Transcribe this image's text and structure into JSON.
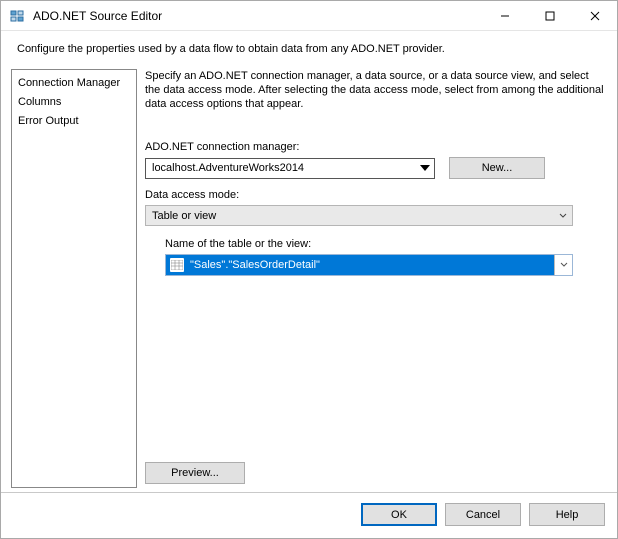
{
  "window": {
    "title": "ADO.NET Source Editor"
  },
  "description": "Configure the properties used by a data flow to obtain data from any ADO.NET provider.",
  "sidebar": {
    "items": [
      {
        "label": "Connection Manager"
      },
      {
        "label": "Columns"
      },
      {
        "label": "Error Output"
      }
    ]
  },
  "main": {
    "instructions": "Specify an ADO.NET connection manager, a data source, or a data source view, and select the data access mode. After selecting the data access mode, select from among the additional data access options that appear.",
    "cm_label": "ADO.NET connection manager:",
    "cm_value": "localhost.AdventureWorks2014",
    "new_label": "New...",
    "mode_label": "Data access mode:",
    "mode_value": "Table or view",
    "table_label": "Name of the table or the view:",
    "table_value": "\"Sales\".\"SalesOrderDetail\"",
    "preview_label": "Preview..."
  },
  "footer": {
    "ok": "OK",
    "cancel": "Cancel",
    "help": "Help"
  }
}
